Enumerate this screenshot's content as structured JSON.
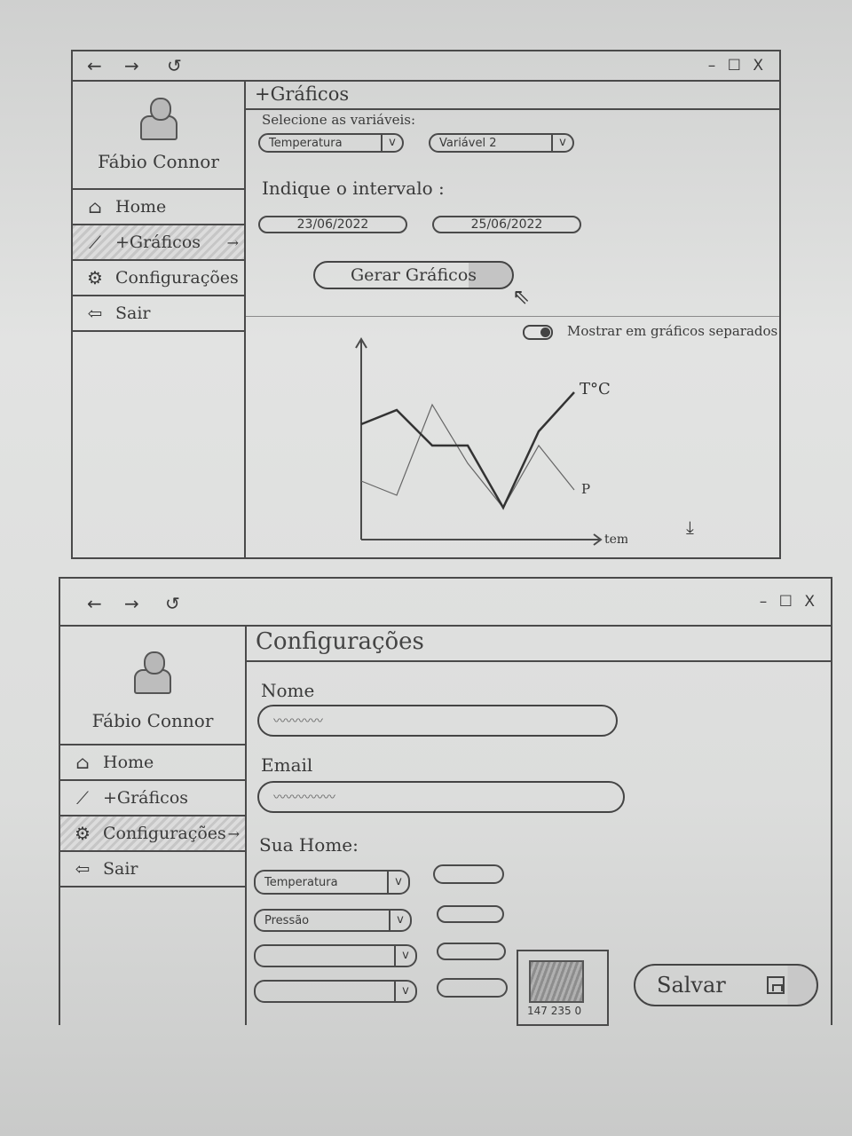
{
  "window1": {
    "user_name": "Fábio Connor",
    "menu": [
      {
        "label": "Home",
        "icon": "home-icon"
      },
      {
        "label": "+Gráficos",
        "icon": "chart-icon",
        "active": true
      },
      {
        "label": "Configurações",
        "icon": "gear-icon"
      },
      {
        "label": "Sair",
        "icon": "logout-icon"
      }
    ],
    "page_title": "+Gráficos",
    "select_label": "Selecione as variáveis:",
    "variable1": "Temperatura",
    "variable2": "Variável 2",
    "interval_label": "Indique o intervalo :",
    "date_start": "23/06/2022",
    "date_end": "25/06/2022",
    "generate_button": "Gerar Gráficos",
    "toggle_label": "Mostrar em gráficos separados",
    "chart_data": {
      "type": "line",
      "xlabel": "tempo",
      "series": [
        {
          "name": "T°C",
          "values": [
            62,
            70,
            50,
            50,
            15,
            58,
            80
          ]
        },
        {
          "name": "P",
          "values": [
            30,
            22,
            73,
            40,
            15,
            50,
            25
          ]
        }
      ]
    }
  },
  "window2": {
    "user_name": "Fábio Connor",
    "menu": [
      {
        "label": "Home",
        "icon": "home-icon"
      },
      {
        "label": "+Gráficos",
        "icon": "chart-icon"
      },
      {
        "label": "Configurações",
        "icon": "gear-icon",
        "active": true
      },
      {
        "label": "Sair",
        "icon": "logout-icon"
      }
    ],
    "page_title": "Configurações",
    "name_label": "Nome",
    "email_label": "Email",
    "home_label": "Sua Home:",
    "home_selects": [
      "Temperatura",
      "Pressão",
      "",
      ""
    ],
    "thumb_caption": "147 235 0",
    "save_button": "Salvar"
  },
  "controls": {
    "back": "←",
    "forward": "→",
    "reload": "↺",
    "window_buttons": "– ☐ X"
  }
}
